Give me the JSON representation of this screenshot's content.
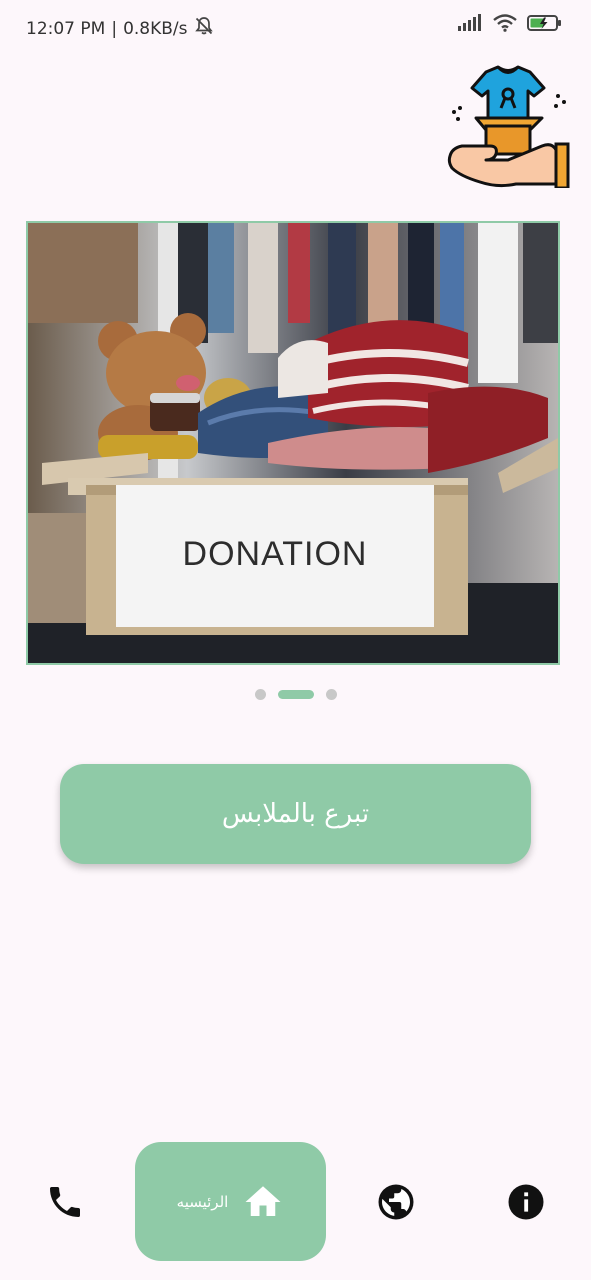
{
  "status_bar": {
    "time": "12:07 PM",
    "network_speed": "0.8KB/s",
    "icons": [
      "mute-bell-icon",
      "signal-icon",
      "wifi-icon",
      "battery-charging-icon"
    ]
  },
  "logo": {
    "icon": "clothes-donation-hand-icon"
  },
  "carousel": {
    "image_text": "DONATION",
    "page_count": 3,
    "active_index": 1
  },
  "donate_button": {
    "label": "تبرع بالملابس"
  },
  "bottom_nav": {
    "items": [
      {
        "icon": "phone-icon"
      },
      {
        "icon": "home-icon",
        "label": "الرئيسيه",
        "active": true
      },
      {
        "icon": "globe-icon"
      },
      {
        "icon": "info-icon"
      }
    ]
  },
  "colors": {
    "accent": "#8fcaa7",
    "background": "#fdf7fb"
  }
}
